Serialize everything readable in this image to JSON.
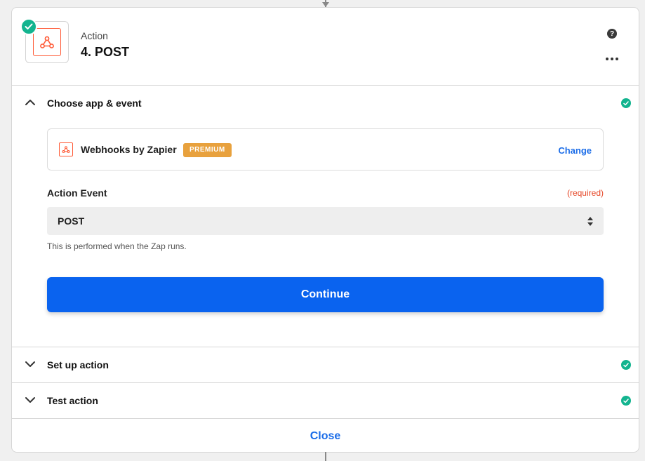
{
  "step": {
    "label": "Action",
    "title": "4. POST"
  },
  "header_icons": {
    "help": "?"
  },
  "sections": {
    "choose": {
      "title": "Choose app & event",
      "app_name": "Webhooks by Zapier",
      "premium_badge": "PREMIUM",
      "change_link": "Change",
      "field_label": "Action Event",
      "required_text": "(required)",
      "selected_event": "POST",
      "helper_text": "This is performed when the Zap runs.",
      "continue_label": "Continue"
    },
    "setup": {
      "title": "Set up action"
    },
    "test": {
      "title": "Test action"
    }
  },
  "footer": {
    "close_label": "Close"
  },
  "colors": {
    "success": "#13b48f",
    "primary": "#0a63ef",
    "link": "#1a6ce8",
    "premium": "#e8a13d",
    "required": "#e5401f",
    "webhook": "#ff5a36"
  }
}
